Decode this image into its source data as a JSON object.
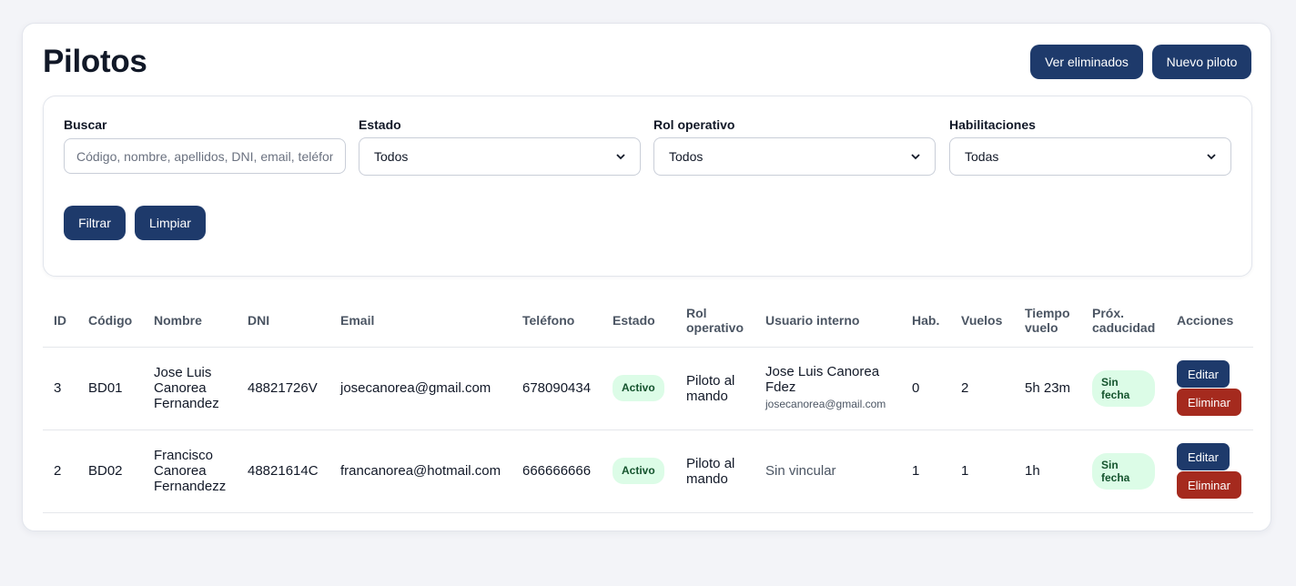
{
  "header": {
    "title": "Pilotos",
    "view_deleted_label": "Ver eliminados",
    "new_pilot_label": "Nuevo piloto"
  },
  "filters": {
    "search": {
      "label": "Buscar",
      "placeholder": "Código, nombre, apellidos, DNI, email, teléfono",
      "value": ""
    },
    "estado": {
      "label": "Estado",
      "selected": "Todos"
    },
    "rol": {
      "label": "Rol operativo",
      "selected": "Todos"
    },
    "habilitaciones": {
      "label": "Habilitaciones",
      "selected": "Todas"
    },
    "filter_label": "Filtrar",
    "clear_label": "Limpiar"
  },
  "table": {
    "columns": {
      "id": "ID",
      "codigo": "Código",
      "nombre": "Nombre",
      "dni": "DNI",
      "email": "Email",
      "telefono": "Teléfono",
      "estado": "Estado",
      "rol": "Rol operativo",
      "usuario": "Usuario interno",
      "hab": "Hab.",
      "vuelos": "Vuelos",
      "tiempo": "Tiempo vuelo",
      "caducidad": "Próx. caducidad",
      "acciones": "Acciones"
    },
    "rows": [
      {
        "id": "3",
        "codigo": "BD01",
        "nombre": "Jose Luis Canorea Fernandez",
        "dni": "48821726V",
        "email": "josecanorea@gmail.com",
        "telefono": "678090434",
        "estado": "Activo",
        "rol": "Piloto al mando",
        "usuario_nombre": "Jose Luis Canorea Fdez",
        "usuario_email": "josecanorea@gmail.com",
        "hab": "0",
        "vuelos": "2",
        "tiempo": "5h 23m",
        "caducidad": "Sin fecha",
        "edit_label": "Editar",
        "delete_label": "Eliminar"
      },
      {
        "id": "2",
        "codigo": "BD02",
        "nombre": "Francisco Canorea Fernandezz",
        "dni": "48821614C",
        "email": "francanorea@hotmail.com",
        "telefono": "666666666",
        "estado": "Activo",
        "rol": "Piloto al mando",
        "usuario_nombre": "Sin vincular",
        "usuario_email": "",
        "hab": "1",
        "vuelos": "1",
        "tiempo": "1h",
        "caducidad": "Sin fecha",
        "edit_label": "Editar",
        "delete_label": "Eliminar"
      }
    ]
  },
  "colors": {
    "primary": "#1e3a6b",
    "danger": "#a52a1e",
    "badge_bg": "#dcfce7",
    "badge_text": "#14532d"
  }
}
